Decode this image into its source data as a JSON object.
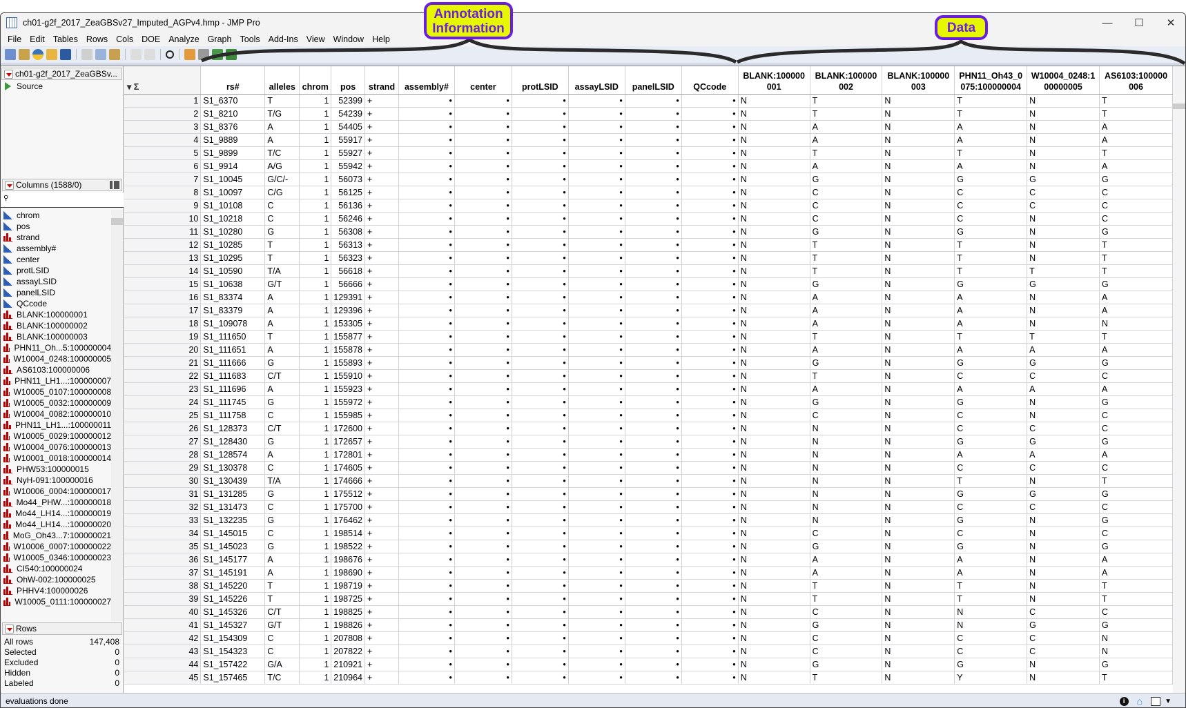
{
  "window": {
    "title": "ch01-g2f_2017_ZeaGBSv27_Imputed_AGPv4.hmp - JMP Pro",
    "minimize": "—",
    "maximize": "☐",
    "close": "✕"
  },
  "menu": [
    "File",
    "Edit",
    "Tables",
    "Rows",
    "Cols",
    "DOE",
    "Analyze",
    "Graph",
    "Tools",
    "Add-Ins",
    "View",
    "Window",
    "Help"
  ],
  "callouts": {
    "annotation": "Annotation Information",
    "data": "Data",
    "color_fill": "#e6f700",
    "color_border": "#6a1fe0"
  },
  "left_panel": {
    "table_name": "ch01-g2f_2017_ZeaGBSv...",
    "source": "Source",
    "columns_header": "Columns (1588/0)",
    "columns": [
      {
        "name": "chrom",
        "type": "continuous"
      },
      {
        "name": "pos",
        "type": "continuous"
      },
      {
        "name": "strand",
        "type": "nominal"
      },
      {
        "name": "assembly#",
        "type": "continuous"
      },
      {
        "name": "center",
        "type": "continuous"
      },
      {
        "name": "protLSID",
        "type": "continuous"
      },
      {
        "name": "assayLSID",
        "type": "continuous"
      },
      {
        "name": "panelLSID",
        "type": "continuous"
      },
      {
        "name": "QCcode",
        "type": "continuous"
      },
      {
        "name": "BLANK:100000001",
        "type": "nominal"
      },
      {
        "name": "BLANK:100000002",
        "type": "nominal"
      },
      {
        "name": "BLANK:100000003",
        "type": "nominal"
      },
      {
        "name": "PHN11_Oh...5:100000004",
        "type": "nominal"
      },
      {
        "name": "W10004_0248:100000005",
        "type": "nominal"
      },
      {
        "name": "AS6103:100000006",
        "type": "nominal"
      },
      {
        "name": "PHN11_LH1...:100000007",
        "type": "nominal"
      },
      {
        "name": "W10005_0107:100000008",
        "type": "nominal"
      },
      {
        "name": "W10005_0032:100000009",
        "type": "nominal"
      },
      {
        "name": "W10004_0082:100000010",
        "type": "nominal"
      },
      {
        "name": "PHN11_LH1...:100000011",
        "type": "nominal"
      },
      {
        "name": "W10005_0029:100000012",
        "type": "nominal"
      },
      {
        "name": "W10004_0076:100000013",
        "type": "nominal"
      },
      {
        "name": "W10001_0018:100000014",
        "type": "nominal"
      },
      {
        "name": "PHW53:100000015",
        "type": "nominal"
      },
      {
        "name": "NyH-091:100000016",
        "type": "nominal"
      },
      {
        "name": "W10006_0004:100000017",
        "type": "nominal"
      },
      {
        "name": "Mo44_PHW...:100000018",
        "type": "nominal"
      },
      {
        "name": "Mo44_LH14...:100000019",
        "type": "nominal"
      },
      {
        "name": "Mo44_LH14...:100000020",
        "type": "nominal"
      },
      {
        "name": "MoG_Oh43...7:100000021",
        "type": "nominal"
      },
      {
        "name": "W10006_0007:100000022",
        "type": "nominal"
      },
      {
        "name": "W10005_0346:100000023",
        "type": "nominal"
      },
      {
        "name": "CI540:100000024",
        "type": "nominal"
      },
      {
        "name": "OhW-002:100000025",
        "type": "nominal"
      },
      {
        "name": "PHHV4:100000026",
        "type": "nominal"
      },
      {
        "name": "W10005_0111:100000027",
        "type": "nominal"
      }
    ],
    "rows_header": "Rows",
    "rows_info": [
      {
        "label": "All rows",
        "value": "147,408"
      },
      {
        "label": "Selected",
        "value": "0"
      },
      {
        "label": "Excluded",
        "value": "0"
      },
      {
        "label": "Hidden",
        "value": "0"
      },
      {
        "label": "Labeled",
        "value": "0"
      }
    ]
  },
  "table": {
    "headers": [
      "rs#",
      "alleles",
      "chrom",
      "pos",
      "strand",
      "assembly#",
      "center",
      "protLSID",
      "assayLSID",
      "panelLSID",
      "QCcode",
      "BLANK:100000001",
      "BLANK:100000002",
      "BLANK:100000003",
      "PHN11_Oh43_0075:100000004",
      "W10004_0248:100000005",
      "AS6103:100000006"
    ],
    "missing": "•",
    "rows": [
      [
        "S1_6370",
        "T",
        "1",
        "52399",
        "+",
        "N",
        "T",
        "N",
        "T",
        "N",
        "T"
      ],
      [
        "S1_8210",
        "T/G",
        "1",
        "54239",
        "+",
        "N",
        "T",
        "N",
        "T",
        "N",
        "T"
      ],
      [
        "S1_8376",
        "A",
        "1",
        "54405",
        "+",
        "N",
        "A",
        "N",
        "A",
        "N",
        "A"
      ],
      [
        "S1_9889",
        "A",
        "1",
        "55917",
        "+",
        "N",
        "A",
        "N",
        "A",
        "N",
        "A"
      ],
      [
        "S1_9899",
        "T/C",
        "1",
        "55927",
        "+",
        "N",
        "T",
        "N",
        "T",
        "N",
        "T"
      ],
      [
        "S1_9914",
        "A/G",
        "1",
        "55942",
        "+",
        "N",
        "A",
        "N",
        "A",
        "N",
        "A"
      ],
      [
        "S1_10045",
        "G/C/-",
        "1",
        "56073",
        "+",
        "N",
        "G",
        "N",
        "G",
        "G",
        "G"
      ],
      [
        "S1_10097",
        "C/G",
        "1",
        "56125",
        "+",
        "N",
        "C",
        "N",
        "C",
        "C",
        "C"
      ],
      [
        "S1_10108",
        "C",
        "1",
        "56136",
        "+",
        "N",
        "C",
        "N",
        "C",
        "C",
        "C"
      ],
      [
        "S1_10218",
        "C",
        "1",
        "56246",
        "+",
        "N",
        "C",
        "N",
        "C",
        "N",
        "C"
      ],
      [
        "S1_10280",
        "G",
        "1",
        "56308",
        "+",
        "N",
        "G",
        "N",
        "G",
        "N",
        "G"
      ],
      [
        "S1_10285",
        "T",
        "1",
        "56313",
        "+",
        "N",
        "T",
        "N",
        "T",
        "N",
        "T"
      ],
      [
        "S1_10295",
        "T",
        "1",
        "56323",
        "+",
        "N",
        "T",
        "N",
        "T",
        "N",
        "T"
      ],
      [
        "S1_10590",
        "T/A",
        "1",
        "56618",
        "+",
        "N",
        "T",
        "N",
        "T",
        "T",
        "T"
      ],
      [
        "S1_10638",
        "G/T",
        "1",
        "56666",
        "+",
        "N",
        "G",
        "N",
        "G",
        "G",
        "G"
      ],
      [
        "S1_83374",
        "A",
        "1",
        "129391",
        "+",
        "N",
        "A",
        "N",
        "A",
        "N",
        "A"
      ],
      [
        "S1_83379",
        "A",
        "1",
        "129396",
        "+",
        "N",
        "A",
        "N",
        "A",
        "N",
        "A"
      ],
      [
        "S1_109078",
        "A",
        "1",
        "153305",
        "+",
        "N",
        "A",
        "N",
        "A",
        "N",
        "N"
      ],
      [
        "S1_111650",
        "T",
        "1",
        "155877",
        "+",
        "N",
        "T",
        "N",
        "T",
        "T",
        "T"
      ],
      [
        "S1_111651",
        "A",
        "1",
        "155878",
        "+",
        "N",
        "A",
        "N",
        "A",
        "A",
        "A"
      ],
      [
        "S1_111666",
        "G",
        "1",
        "155893",
        "+",
        "N",
        "G",
        "N",
        "G",
        "G",
        "G"
      ],
      [
        "S1_111683",
        "C/T",
        "1",
        "155910",
        "+",
        "N",
        "T",
        "N",
        "C",
        "C",
        "C"
      ],
      [
        "S1_111696",
        "A",
        "1",
        "155923",
        "+",
        "N",
        "A",
        "N",
        "A",
        "A",
        "A"
      ],
      [
        "S1_111745",
        "G",
        "1",
        "155972",
        "+",
        "N",
        "G",
        "N",
        "G",
        "N",
        "G"
      ],
      [
        "S1_111758",
        "C",
        "1",
        "155985",
        "+",
        "N",
        "C",
        "N",
        "C",
        "N",
        "C"
      ],
      [
        "S1_128373",
        "C/T",
        "1",
        "172600",
        "+",
        "N",
        "N",
        "N",
        "C",
        "C",
        "C"
      ],
      [
        "S1_128430",
        "G",
        "1",
        "172657",
        "+",
        "N",
        "N",
        "N",
        "G",
        "G",
        "G"
      ],
      [
        "S1_128574",
        "A",
        "1",
        "172801",
        "+",
        "N",
        "N",
        "N",
        "A",
        "A",
        "A"
      ],
      [
        "S1_130378",
        "C",
        "1",
        "174605",
        "+",
        "N",
        "N",
        "N",
        "C",
        "C",
        "C"
      ],
      [
        "S1_130439",
        "T/A",
        "1",
        "174666",
        "+",
        "N",
        "N",
        "N",
        "T",
        "N",
        "T"
      ],
      [
        "S1_131285",
        "G",
        "1",
        "175512",
        "+",
        "N",
        "N",
        "N",
        "G",
        "G",
        "G"
      ],
      [
        "S1_131473",
        "C",
        "1",
        "175700",
        "+",
        "N",
        "N",
        "N",
        "C",
        "C",
        "C"
      ],
      [
        "S1_132235",
        "G",
        "1",
        "176462",
        "+",
        "N",
        "N",
        "N",
        "G",
        "N",
        "G"
      ],
      [
        "S1_145015",
        "C",
        "1",
        "198514",
        "+",
        "N",
        "C",
        "N",
        "C",
        "N",
        "C"
      ],
      [
        "S1_145023",
        "G",
        "1",
        "198522",
        "+",
        "N",
        "G",
        "N",
        "G",
        "N",
        "G"
      ],
      [
        "S1_145177",
        "A",
        "1",
        "198676",
        "+",
        "N",
        "A",
        "N",
        "A",
        "N",
        "A"
      ],
      [
        "S1_145191",
        "A",
        "1",
        "198690",
        "+",
        "N",
        "A",
        "N",
        "A",
        "N",
        "A"
      ],
      [
        "S1_145220",
        "T",
        "1",
        "198719",
        "+",
        "N",
        "T",
        "N",
        "T",
        "N",
        "T"
      ],
      [
        "S1_145226",
        "T",
        "1",
        "198725",
        "+",
        "N",
        "T",
        "N",
        "T",
        "N",
        "T"
      ],
      [
        "S1_145326",
        "C/T",
        "1",
        "198825",
        "+",
        "N",
        "C",
        "N",
        "N",
        "C",
        "C"
      ],
      [
        "S1_145327",
        "G/T",
        "1",
        "198826",
        "+",
        "N",
        "G",
        "N",
        "N",
        "G",
        "G"
      ],
      [
        "S1_154309",
        "C",
        "1",
        "207808",
        "+",
        "N",
        "C",
        "N",
        "C",
        "C",
        "N"
      ],
      [
        "S1_154323",
        "C",
        "1",
        "207822",
        "+",
        "N",
        "C",
        "N",
        "C",
        "C",
        "N"
      ],
      [
        "S1_157422",
        "G/A",
        "1",
        "210921",
        "+",
        "N",
        "G",
        "N",
        "G",
        "N",
        "G"
      ],
      [
        "S1_157465",
        "T/C",
        "1",
        "210964",
        "+",
        "N",
        "T",
        "N",
        "Y",
        "N",
        "T"
      ]
    ]
  },
  "status": {
    "text": "evaluations done"
  }
}
